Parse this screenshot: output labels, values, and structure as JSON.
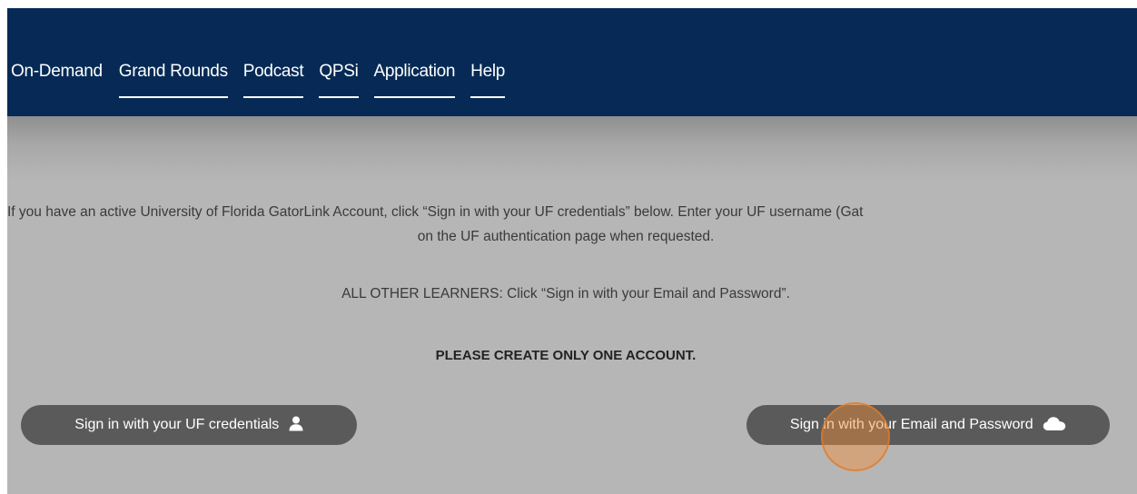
{
  "nav": {
    "items": [
      {
        "label": "On-Demand"
      },
      {
        "label": "Grand Rounds"
      },
      {
        "label": "Podcast"
      },
      {
        "label": "QPSi"
      },
      {
        "label": "Application"
      },
      {
        "label": "Help"
      }
    ]
  },
  "main": {
    "intro_line1": "If you have an active University of Florida GatorLink Account, click “Sign in with your UF credentials” below. Enter your UF username (Gat",
    "intro_line2": "on the UF authentication page when requested.",
    "other_learners": "ALL OTHER LEARNERS: Click “Sign in with your Email and Password”.",
    "notice": "PLEASE CREATE ONLY ONE ACCOUNT.",
    "uf_button_label": "Sign in with your UF credentials",
    "email_button_label": "Sign in with your Email and Password",
    "uf_button_icon": "user-icon",
    "email_button_icon": "cloud-icon"
  },
  "colors": {
    "navbar": "#062a55",
    "page_background": "#b6b6b6",
    "button_background": "#5a5a5a",
    "click_highlight": "#f28e3a"
  }
}
